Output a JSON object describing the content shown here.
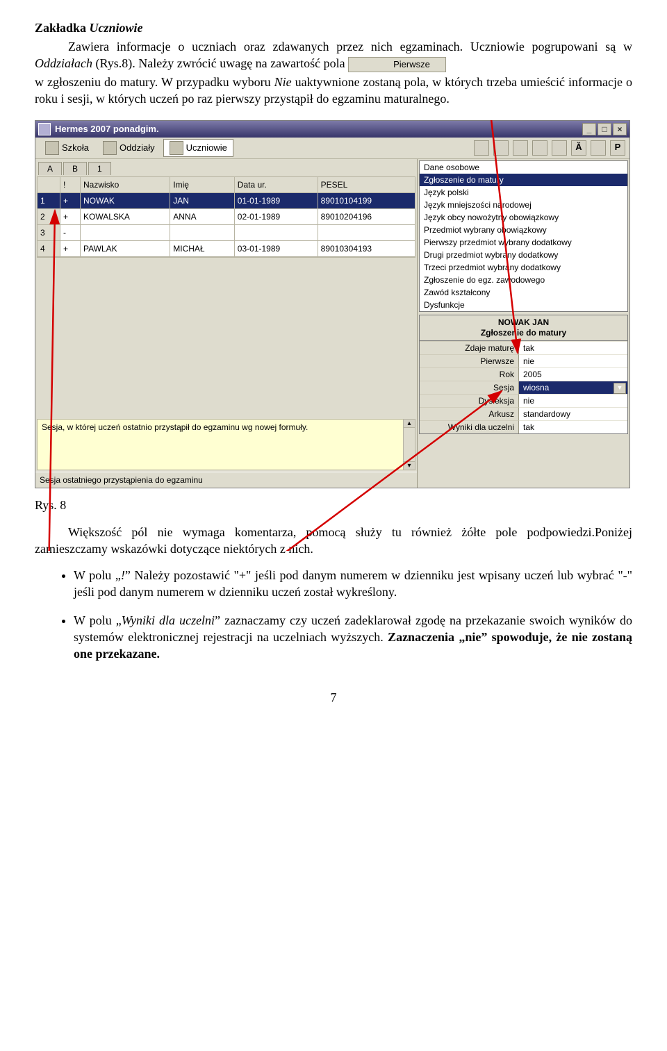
{
  "heading_prefix": "Zakładka ",
  "heading_em": "Uczniowie",
  "p1a": "Zawiera informacje o uczniach oraz zdawanych przez nich egzaminach. Uczniowie pogrupowani są w ",
  "p1b": "Oddziałach",
  "p1c": " (Rys.8). Należy zwrócić uwagę na zawartość pola ",
  "pierwsze_chip": "Pierwsze",
  "p2a": "w zgłoszeniu do matury. W przypadku wyboru ",
  "p2b": "Nie",
  "p2c": " uaktywnione zostaną pola, w których trzeba umieścić informacje o roku i sesji, w których uczeń po raz pierwszy przystąpił do egzaminu maturalnego.",
  "app": {
    "title": "Hermes 2007 ponadgim.",
    "win_min": "_",
    "win_max": "□",
    "win_close": "×",
    "menu": {
      "szkola": "Szkoła",
      "oddzialy": "Oddziały",
      "uczniowie": "Uczniowie"
    },
    "tool": {
      "a_btn": "Ă",
      "p_btn": "P"
    },
    "subtabs": [
      "A",
      "B",
      "1"
    ],
    "cols": {
      "n": "",
      "ex": "!",
      "nazwisko": "Nazwisko",
      "imie": "Imię",
      "data": "Data ur.",
      "pesel": "PESEL"
    },
    "rows": [
      {
        "n": "1",
        "ex": "+",
        "nazwisko": "NOWAK",
        "imie": "JAN",
        "data": "01-01-1989",
        "pesel": "89010104199",
        "sel": true
      },
      {
        "n": "2",
        "ex": "+",
        "nazwisko": "KOWALSKA",
        "imie": "ANNA",
        "data": "02-01-1989",
        "pesel": "89010204196",
        "sel": false
      },
      {
        "n": "3",
        "ex": "-",
        "nazwisko": "",
        "imie": "",
        "data": "",
        "pesel": "",
        "sel": false
      },
      {
        "n": "4",
        "ex": "+",
        "nazwisko": "PAWLAK",
        "imie": "MICHAŁ",
        "data": "03-01-1989",
        "pesel": "89010304193",
        "sel": false
      }
    ],
    "hint": "Sesja, w której uczeń ostatnio przystąpił do egzaminu wg nowej formuły.",
    "status": "Sesja ostatniego przystąpienia do egzaminu",
    "categories": [
      "Dane osobowe",
      "Zgłoszenie do matury",
      "Język polski",
      "Język mniejszości narodowej",
      "Język obcy nowożytny obowiązkowy",
      "Przedmiot wybrany obowiązkowy",
      "Pierwszy przedmiot wybrany dodatkowy",
      "Drugi przedmiot wybrany dodatkowy",
      "Trzeci przedmiot wybrany dodatkowy",
      "Zgłoszenie do egz. zawodowego",
      "Zawód kształcony",
      "Dysfunkcje"
    ],
    "cat_selected_index": 1,
    "detail_title1": "NOWAK JAN",
    "detail_title2": "Zgłoszenie do matury",
    "details": [
      {
        "label": "Zdaje maturę",
        "value": "tak"
      },
      {
        "label": "Pierwsze",
        "value": "nie"
      },
      {
        "label": "Rok",
        "value": "2005"
      },
      {
        "label": "Sesja",
        "value": "wiosna",
        "sel": true,
        "dd": true
      },
      {
        "label": "Dysleksja",
        "value": "nie"
      },
      {
        "label": "Arkusz",
        "value": "standardowy"
      },
      {
        "label": "Wyniki dla uczelni",
        "value": "tak"
      }
    ]
  },
  "caption": "Rys. 8",
  "p3": "Większość pól nie wymaga komentarza, pomocą służy tu również żółte pole podpowiedzi.Poniżej zamieszczamy wskazówki dotyczące niektórych z nich.",
  "b1a": "W polu „",
  "b1b": "!",
  "b1c": "” Należy pozostawić \"+\" jeśli pod danym numerem w dzienniku jest wpisany uczeń lub wybrać \"-\" jeśli pod danym numerem w dzienniku uczeń został wykreślony.",
  "b2a": "W polu „",
  "b2b": "Wyniki dla uczelni",
  "b2c": "” zaznaczamy czy uczeń zadeklarował zgodę na przekazanie swoich wyników do systemów elektronicznej rejestracji na uczelniach wyższych. ",
  "b2d": "Zaznaczenia „nie” spowoduje, że nie zostaną one przekazane.",
  "pagenum": "7"
}
